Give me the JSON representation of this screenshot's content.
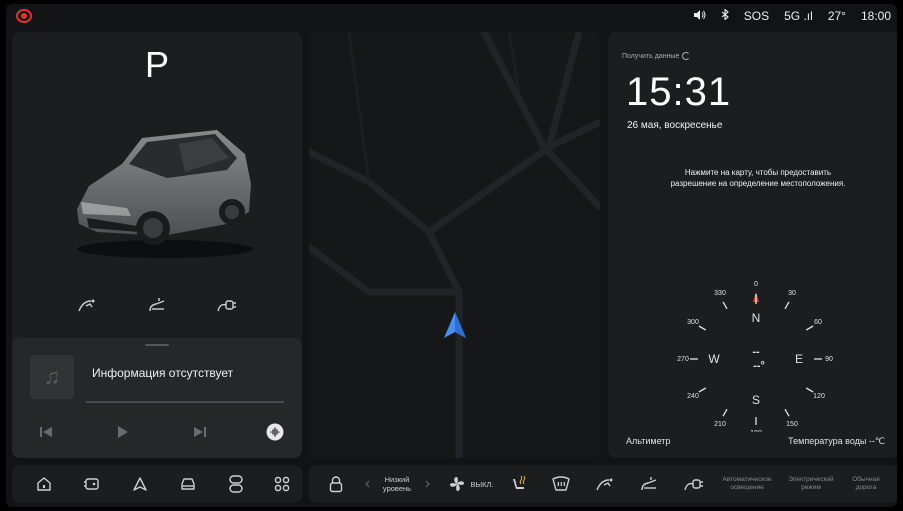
{
  "status": {
    "left_icon": "parking-brake-warning-icon",
    "volume_icon": "volume-icon",
    "bluetooth_icon": "bluetooth-icon",
    "sos": "SOS",
    "signal": "5G .ıl",
    "temperature": "27°",
    "time": "18:00",
    "accent": "#e0342c"
  },
  "vehicle": {
    "gear": "P",
    "controls": [
      "charge-port-icon",
      "trunk-icon",
      "charge-plug-icon"
    ]
  },
  "media": {
    "track": "Информация отсутствует",
    "icons": [
      "music-note-icon",
      "previous-icon",
      "play-icon",
      "next-icon",
      "voice-icon"
    ]
  },
  "info": {
    "get_data": "Получить данные",
    "clock": "15:31",
    "date": "26 мая, воскресенье",
    "location_msg_line1": "Нажмите на карту, чтобы предоставить",
    "location_msg_line2": "разрешение на определение местоположения.",
    "altitude_label": "Альтиметр",
    "water_temp_label": "Температура воды --℃",
    "compass": {
      "north": "N",
      "east": "E",
      "south": "S",
      "west": "W",
      "readout_top": "--",
      "readout_bottom": "--°",
      "ticks": [
        "0",
        "30",
        "60",
        "90",
        "120",
        "150",
        "180",
        "210",
        "240",
        "270",
        "300",
        "330"
      ]
    }
  },
  "dock_left": {
    "icons": [
      "home-icon",
      "car-app-icon",
      "navigation-icon",
      "vehicle-icon",
      "media-icon",
      "apps-icon"
    ]
  },
  "dock_right": {
    "lock_icon": "lock-icon",
    "fan_level_line1": "Низкий",
    "fan_level_line2": "уровень",
    "fan_state": "ВЫКЛ.",
    "light_mode_line1": "Автоматическое",
    "light_mode_line2": "освещение",
    "drive_mode_line1": "Электрический",
    "drive_mode_line2": "режим",
    "road_mode_line1": "Обычная",
    "road_mode_line2": "дорога"
  }
}
